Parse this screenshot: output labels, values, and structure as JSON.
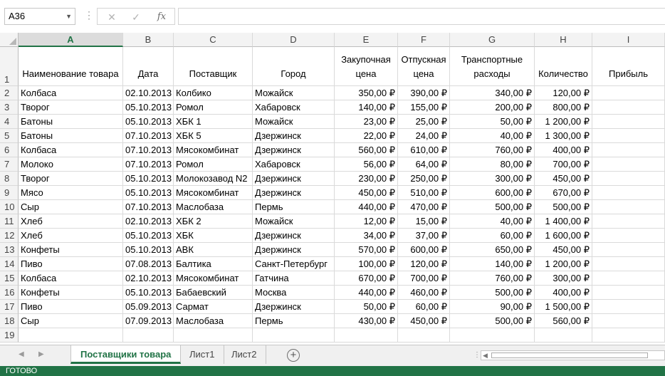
{
  "formula_bar": {
    "name_box": "A36",
    "cancel_icon": "✕",
    "enter_icon": "✓",
    "fx_icon": "fx",
    "formula": ""
  },
  "columns": [
    "A",
    "B",
    "C",
    "D",
    "E",
    "F",
    "G",
    "H",
    "I"
  ],
  "selected_column": "A",
  "header_row": {
    "row_number": "1",
    "cells": [
      "Наименование товара",
      "Дата",
      "Поставщик",
      "Город",
      "Закупочная цена",
      "Отпускная цена",
      "Транспортные расходы",
      "Количество",
      "Прибыль"
    ]
  },
  "rows": [
    {
      "n": "2",
      "cells": [
        "Колбаса",
        "02.10.2013",
        "Колбико",
        "Можайск",
        "350,00 ₽",
        "390,00 ₽",
        "340,00 ₽",
        "120,00 ₽",
        ""
      ]
    },
    {
      "n": "3",
      "cells": [
        "Творог",
        "05.10.2013",
        "Ромол",
        "Хабаровск",
        "140,00 ₽",
        "155,00 ₽",
        "200,00 ₽",
        "800,00 ₽",
        ""
      ]
    },
    {
      "n": "4",
      "cells": [
        "Батоны",
        "05.10.2013",
        "ХБК 1",
        "Можайск",
        "23,00 ₽",
        "25,00 ₽",
        "50,00 ₽",
        "1 200,00 ₽",
        ""
      ]
    },
    {
      "n": "5",
      "cells": [
        "Батоны",
        "07.10.2013",
        "ХБК 5",
        "Дзержинск",
        "22,00 ₽",
        "24,00 ₽",
        "40,00 ₽",
        "1 300,00 ₽",
        ""
      ]
    },
    {
      "n": "6",
      "cells": [
        "Колбаса",
        "07.10.2013",
        "Мясокомбинат",
        "Дзержинск",
        "560,00 ₽",
        "610,00 ₽",
        "760,00 ₽",
        "400,00 ₽",
        ""
      ]
    },
    {
      "n": "7",
      "cells": [
        "Молоко",
        "07.10.2013",
        "Ромол",
        "Хабаровск",
        "56,00 ₽",
        "64,00 ₽",
        "80,00 ₽",
        "700,00 ₽",
        ""
      ]
    },
    {
      "n": "8",
      "cells": [
        "Творог",
        "05.10.2013",
        "Молокозавод N2",
        "Дзержинск",
        "230,00 ₽",
        "250,00 ₽",
        "300,00 ₽",
        "450,00 ₽",
        ""
      ]
    },
    {
      "n": "9",
      "cells": [
        "Мясо",
        "05.10.2013",
        "Мясокомбинат",
        "Дзержинск",
        "450,00 ₽",
        "510,00 ₽",
        "600,00 ₽",
        "670,00 ₽",
        ""
      ]
    },
    {
      "n": "10",
      "cells": [
        "Сыр",
        "07.10.2013",
        "Маслобаза",
        "Пермь",
        "440,00 ₽",
        "470,00 ₽",
        "500,00 ₽",
        "500,00 ₽",
        ""
      ]
    },
    {
      "n": "11",
      "cells": [
        "Хлеб",
        "02.10.2013",
        "ХБК 2",
        "Можайск",
        "12,00 ₽",
        "15,00 ₽",
        "40,00 ₽",
        "1 400,00 ₽",
        ""
      ]
    },
    {
      "n": "12",
      "cells": [
        "Хлеб",
        "05.10.2013",
        "ХБК",
        "Дзержинск",
        "34,00 ₽",
        "37,00 ₽",
        "60,00 ₽",
        "1 600,00 ₽",
        ""
      ]
    },
    {
      "n": "13",
      "cells": [
        "Конфеты",
        "05.10.2013",
        "АВК",
        "Дзержинск",
        "570,00 ₽",
        "600,00 ₽",
        "650,00 ₽",
        "450,00 ₽",
        ""
      ]
    },
    {
      "n": "14",
      "cells": [
        "Пиво",
        "07.08.2013",
        "Балтика",
        "Санкт-Петербург",
        "100,00 ₽",
        "120,00 ₽",
        "140,00 ₽",
        "1 200,00 ₽",
        ""
      ]
    },
    {
      "n": "15",
      "cells": [
        "Колбаса",
        "02.10.2013",
        "Мясокомбинат",
        "Гатчина",
        "670,00 ₽",
        "700,00 ₽",
        "760,00 ₽",
        "300,00 ₽",
        ""
      ]
    },
    {
      "n": "16",
      "cells": [
        "Конфеты",
        "05.10.2013",
        "Бабаевский",
        "Москва",
        "440,00 ₽",
        "460,00 ₽",
        "500,00 ₽",
        "400,00 ₽",
        ""
      ]
    },
    {
      "n": "17",
      "cells": [
        "Пиво",
        "05.09.2013",
        "Сармат",
        "Дзержинск",
        "50,00 ₽",
        "60,00 ₽",
        "90,00 ₽",
        "1 500,00 ₽",
        ""
      ]
    },
    {
      "n": "18",
      "cells": [
        "Сыр",
        "07.09.2013",
        "Маслобаза",
        "Пермь",
        "430,00 ₽",
        "450,00 ₽",
        "500,00 ₽",
        "560,00 ₽",
        ""
      ]
    },
    {
      "n": "19",
      "cells": [
        "",
        "",
        "",
        "",
        "",
        "",
        "",
        "",
        ""
      ]
    }
  ],
  "sheet_tabs": {
    "active": "Поставщики товара",
    "others": [
      "Лист1",
      "Лист2"
    ],
    "add_icon": "+"
  },
  "status_bar": {
    "text": "ГОТОВО"
  },
  "colors": {
    "accent": "#217346",
    "grid_line": "#dadada",
    "header_bg": "#f3f3f3"
  }
}
